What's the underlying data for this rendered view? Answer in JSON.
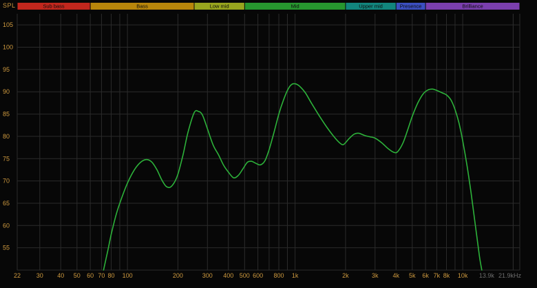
{
  "meta": {
    "bg_color": "#070707",
    "grid_color": "#2b2b2b",
    "label_color": "#cf9a3f",
    "dim_label_color": "#6e6e6e",
    "curve_color": "#2db23a",
    "band_text_color": "#0d0d0d"
  },
  "axis": {
    "spl_label": "SPL",
    "y_ticks": [
      105,
      100,
      95,
      90,
      85,
      80,
      75,
      70,
      65,
      60,
      55
    ],
    "x_ticks": [
      {
        "label": "22",
        "hz": 22
      },
      {
        "label": "30",
        "hz": 30
      },
      {
        "label": "40",
        "hz": 40
      },
      {
        "label": "50",
        "hz": 50
      },
      {
        "label": "60",
        "hz": 60
      },
      {
        "label": "70",
        "hz": 70
      },
      {
        "label": "80",
        "hz": 80
      },
      {
        "label": "100",
        "hz": 100
      },
      {
        "label": "200",
        "hz": 200
      },
      {
        "label": "300",
        "hz": 300
      },
      {
        "label": "400",
        "hz": 400
      },
      {
        "label": "500",
        "hz": 500
      },
      {
        "label": "600",
        "hz": 600
      },
      {
        "label": "800",
        "hz": 800
      },
      {
        "label": "1k",
        "hz": 1000
      },
      {
        "label": "2k",
        "hz": 2000
      },
      {
        "label": "3k",
        "hz": 3000
      },
      {
        "label": "4k",
        "hz": 4000
      },
      {
        "label": "5k",
        "hz": 5000
      },
      {
        "label": "6k",
        "hz": 6000
      },
      {
        "label": "7k",
        "hz": 7000
      },
      {
        "label": "8k",
        "hz": 8000
      },
      {
        "label": "10k",
        "hz": 10000
      },
      {
        "label": "13.9k",
        "hz": 13900,
        "dim": true
      },
      {
        "label": "21.9kHz",
        "hz": 21900,
        "dim": true,
        "anchor": "end"
      }
    ]
  },
  "bands": [
    {
      "label": "Sub bass",
      "from_hz": 22,
      "to_hz": 60,
      "color": "#c1271d"
    },
    {
      "label": "Bass",
      "from_hz": 60,
      "to_hz": 250,
      "color": "#b8860b"
    },
    {
      "label": "Low mid",
      "from_hz": 250,
      "to_hz": 500,
      "color": "#98a51e"
    },
    {
      "label": "Mid",
      "from_hz": 500,
      "to_hz": 2000,
      "color": "#27962f"
    },
    {
      "label": "Upper mid",
      "from_hz": 2000,
      "to_hz": 4000,
      "color": "#12857d"
    },
    {
      "label": "Presence",
      "from_hz": 4000,
      "to_hz": 6000,
      "color": "#3b4fc0"
    },
    {
      "label": "Brilliance",
      "from_hz": 6000,
      "to_hz": 21900,
      "color": "#7a3fae"
    }
  ],
  "chart_data": {
    "type": "line",
    "title": "",
    "xlabel": "",
    "ylabel": "SPL",
    "x_scale": "log",
    "xlim": [
      22,
      21900
    ],
    "ylim": [
      50,
      107.5
    ],
    "grid": true,
    "legend": false,
    "series": [
      {
        "name": "SPL",
        "color": "#2db23a",
        "points": [
          [
            72,
            50
          ],
          [
            76,
            54
          ],
          [
            80,
            58
          ],
          [
            85,
            62
          ],
          [
            90,
            65
          ],
          [
            100,
            69.5
          ],
          [
            110,
            72.5
          ],
          [
            120,
            74.2
          ],
          [
            130,
            74.8
          ],
          [
            140,
            74.2
          ],
          [
            150,
            72.5
          ],
          [
            160,
            70.3
          ],
          [
            170,
            68.8
          ],
          [
            180,
            68.6
          ],
          [
            190,
            69.6
          ],
          [
            200,
            71.5
          ],
          [
            215,
            76
          ],
          [
            230,
            81
          ],
          [
            250,
            85.3
          ],
          [
            265,
            85.6
          ],
          [
            280,
            84.8
          ],
          [
            300,
            81.7
          ],
          [
            325,
            78
          ],
          [
            350,
            75.8
          ],
          [
            375,
            73.5
          ],
          [
            400,
            72
          ],
          [
            430,
            70.7
          ],
          [
            460,
            71.3
          ],
          [
            490,
            72.8
          ],
          [
            520,
            74.2
          ],
          [
            550,
            74.4
          ],
          [
            580,
            74
          ],
          [
            620,
            73.6
          ],
          [
            660,
            74.5
          ],
          [
            700,
            77
          ],
          [
            750,
            81
          ],
          [
            800,
            85
          ],
          [
            850,
            88
          ],
          [
            900,
            90.3
          ],
          [
            950,
            91.6
          ],
          [
            1000,
            91.8
          ],
          [
            1060,
            91.3
          ],
          [
            1150,
            89.8
          ],
          [
            1250,
            87.5
          ],
          [
            1400,
            84.5
          ],
          [
            1550,
            82
          ],
          [
            1700,
            80
          ],
          [
            1850,
            78.5
          ],
          [
            1950,
            78.2
          ],
          [
            2100,
            79.5
          ],
          [
            2250,
            80.5
          ],
          [
            2400,
            80.7
          ],
          [
            2600,
            80.2
          ],
          [
            2800,
            79.9
          ],
          [
            3000,
            79.6
          ],
          [
            3300,
            78.5
          ],
          [
            3600,
            77.2
          ],
          [
            3900,
            76.4
          ],
          [
            4100,
            76.6
          ],
          [
            4400,
            78.5
          ],
          [
            4700,
            81.5
          ],
          [
            5000,
            84.5
          ],
          [
            5400,
            87.5
          ],
          [
            5800,
            89.5
          ],
          [
            6200,
            90.4
          ],
          [
            6600,
            90.6
          ],
          [
            7000,
            90.3
          ],
          [
            7500,
            89.8
          ],
          [
            8000,
            89.3
          ],
          [
            8500,
            88.2
          ],
          [
            9000,
            86
          ],
          [
            9500,
            83
          ],
          [
            10000,
            79
          ],
          [
            10600,
            73.5
          ],
          [
            11200,
            67.5
          ],
          [
            11900,
            60
          ],
          [
            12600,
            53
          ],
          [
            13000,
            50
          ]
        ]
      }
    ]
  }
}
